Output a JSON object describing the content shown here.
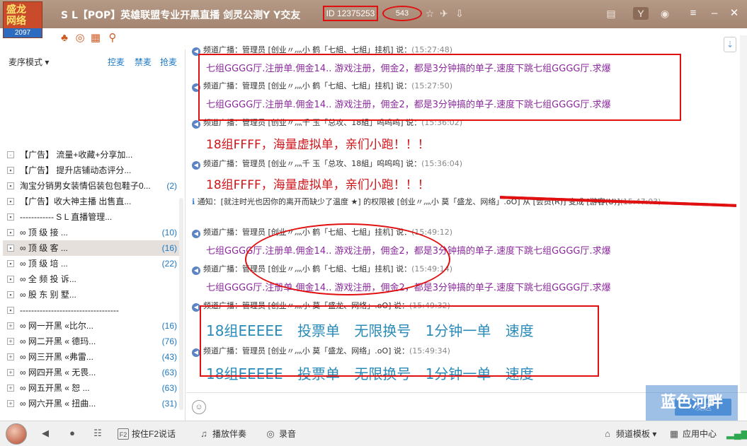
{
  "logo": {
    "text": "盛龙网络",
    "count": "2097"
  },
  "title": "S L【POP】英雄联盟专业开黑直播 剑灵公测Y Y交友",
  "channel_id": "ID 12375253",
  "online_count": "543",
  "left": {
    "sort_mode": "麦序模式",
    "actions": [
      "控麦",
      "禁麦",
      "抢麦"
    ],
    "tree": [
      {
        "label": "【广告】 流量+收藏+分享加...",
        "count": ""
      },
      {
        "label": "【广告】 提升店铺动态评分...",
        "count": ""
      },
      {
        "label": "淘宝分销男女装情侣装包包鞋子0...",
        "count": "(2)"
      },
      {
        "label": "【广告】收大神主播 出售直...",
        "count": ""
      },
      {
        "label": "------------ S L 直播管理...",
        "count": ""
      },
      {
        "label": "∞ 顶 级 接 ...",
        "count": "(10)"
      },
      {
        "label": "∞ 顶 级 客 ...",
        "count": "(16)"
      },
      {
        "label": "∞ 顶 级 培 ...",
        "count": "(22)"
      },
      {
        "label": "∞ 全 频 投 诉...",
        "count": ""
      },
      {
        "label": "∞ 股 东 别 墅...",
        "count": ""
      },
      {
        "label": "-----------------------------------",
        "count": ""
      },
      {
        "label": "∞ 网一开黑 «比尔...",
        "count": "(16)"
      },
      {
        "label": "∞ 网二开黑 « 德玛...",
        "count": "(76)"
      },
      {
        "label": "∞ 网三开黑 «弗雷...",
        "count": "(43)"
      },
      {
        "label": "∞ 网四开黑 « 无畏...",
        "count": "(63)"
      },
      {
        "label": "∞ 网五开黑 « 恕 ...",
        "count": "(63)"
      },
      {
        "label": "∞ 网六开黑 « 扭曲...",
        "count": "(31)"
      }
    ]
  },
  "chat": {
    "messages": [
      {
        "head": "频道广播：管理员 [创业〃灬小 鹤「七組、七組」挂机] 说：",
        "time": "(15:27:48)",
        "body": "七组GGGG厅.注册单.佣金14.. 游戏注册，佣金2，都是3分钟搞的单子.速度下跳七组GGGG厅.求爆"
      },
      {
        "head": "频道广播：管理员 [创业〃灬小 鹤「七組、七組」挂机] 说：",
        "time": "(15:27:50)",
        "body": "七组GGGG厅.注册单.佣金14.. 游戏注册，佣金2，都是3分钟搞的单子.速度下跳七组GGGG厅.求爆"
      },
      {
        "head": "频道广播：管理员 [创业〃灬千 玉「总攻、18組」呜呜呜] 说：",
        "time": "(15:36:02)",
        "body": "18组FFFF，海量虚拟单，亲们小跑！！！"
      },
      {
        "head": "频道广播：管理员 [创业〃灬千 玉「总攻、18組」呜呜呜] 说：",
        "time": "(15:36:04)",
        "body": "18组FFFF，海量虚拟单，亲们小跑！！！"
      },
      {
        "head": "通知：[就注时光也因你的离开而缺少了温度 ★] 的权限被 [创业〃灬小 莫「盛龙、网络」.oO] 从 [会员(R)] 变成 [游客(U)]",
        "time": "(15:47:03)",
        "body": ""
      },
      {
        "head": "频道广播：管理员 [创业〃灬小 鹤「七組、七組」挂机] 说：",
        "time": "(15:49:12)",
        "body": "七组GGGG厅.注册单.佣金14.. 游戏注册，佣金2，都是3分钟搞的单子.速度下跳七组GGGG厅.求爆"
      },
      {
        "head": "频道广播：管理员 [创业〃灬小 鹤「七組、七組」挂机] 说：",
        "time": "(15:49:14)",
        "body": "七组GGGG厅.注册单.佣金14.. 游戏注册，佣金2，都是3分钟搞的单子.速度下跳七组GGGG厅.求爆"
      },
      {
        "head": "频道广播：管理员 [创业〃灬小 莫「盛龙、网络」.oO] 说：",
        "time": "(15:49:32)",
        "body": "18组EEEEE 投票单 无限换号 1分钟一单 速度"
      },
      {
        "head": "频道广播：管理员 [创业〃灬小 莫「盛龙、网络」.oO] 说：",
        "time": "(15:49:34)",
        "body": "18组EEEEE 投票单 无限换号 1分钟一单 速度"
      }
    ]
  },
  "input": {
    "send_label": "发送"
  },
  "bottom": {
    "talk": "按住F2说话",
    "music": "播放伴奏",
    "record": "录音",
    "template": "频道模板",
    "app_center": "应用中心"
  },
  "watermark": "蓝色河畔"
}
